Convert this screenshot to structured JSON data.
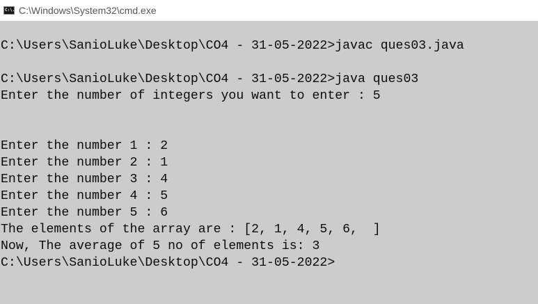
{
  "window": {
    "title": "C:\\Windows\\System32\\cmd.exe",
    "icon": "cmd-icon",
    "icon_text": "C:\\."
  },
  "console": {
    "background": "#cccccc",
    "lines": [
      "",
      "C:\\Users\\SanioLuke\\Desktop\\CO4 - 31-05-2022>javac ques03.java",
      "",
      "C:\\Users\\SanioLuke\\Desktop\\CO4 - 31-05-2022>java ques03",
      "Enter the number of integers you want to enter : 5",
      "",
      "",
      "Enter the number 1 : 2",
      "Enter the number 2 : 1",
      "Enter the number 3 : 4",
      "Enter the number 4 : 5",
      "Enter the number 5 : 6",
      "The elements of the array are : [2, 1, 4, 5, 6,  ]",
      "Now, The average of 5 no of elements is: 3",
      "C:\\Users\\SanioLuke\\Desktop\\CO4 - 31-05-2022>"
    ]
  }
}
